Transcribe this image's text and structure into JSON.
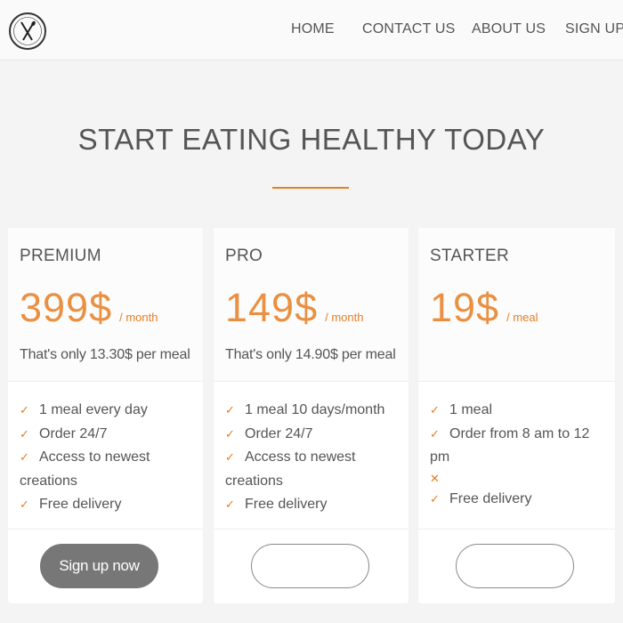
{
  "header": {
    "nav": [
      {
        "label": "HOME"
      },
      {
        "label": "CONTACT US"
      },
      {
        "label": "ABOUT US"
      },
      {
        "label": "SIGN UP"
      }
    ]
  },
  "hero": {
    "title": "START EATING HEALTHY TODAY",
    "accent_color": "#e67e22"
  },
  "plans": [
    {
      "name": "PREMIUM",
      "price": "399$",
      "period": "/ month",
      "per_meal": "That's only 13.30$ per meal",
      "features": [
        {
          "icon": "check-icon",
          "text": "1 meal every day"
        },
        {
          "icon": "check-icon",
          "text": "Order 24/7"
        },
        {
          "icon": "check-icon",
          "text": "Access to newest creations"
        },
        {
          "icon": "check-icon",
          "text": "Free delivery"
        }
      ],
      "button": "Sign up now"
    },
    {
      "name": "PRO",
      "price": "149$",
      "period": "/ month",
      "per_meal": "That's only 14.90$ per meal",
      "features": [
        {
          "icon": "check-icon",
          "text": "1 meal 10 days/month"
        },
        {
          "icon": "check-icon",
          "text": "Order 24/7"
        },
        {
          "icon": "check-icon",
          "text": "Access to newest creations"
        },
        {
          "icon": "check-icon",
          "text": "Free delivery"
        }
      ],
      "button": ""
    },
    {
      "name": "STARTER",
      "price": "19$",
      "period": "/ meal",
      "per_meal": "",
      "features": [
        {
          "icon": "check-icon",
          "text": "1 meal"
        },
        {
          "icon": "check-icon",
          "text": "Order from 8 am to 12 pm"
        },
        {
          "icon": "cross-icon",
          "text": ""
        },
        {
          "icon": "check-icon",
          "text": "Free delivery"
        }
      ],
      "button": ""
    }
  ]
}
